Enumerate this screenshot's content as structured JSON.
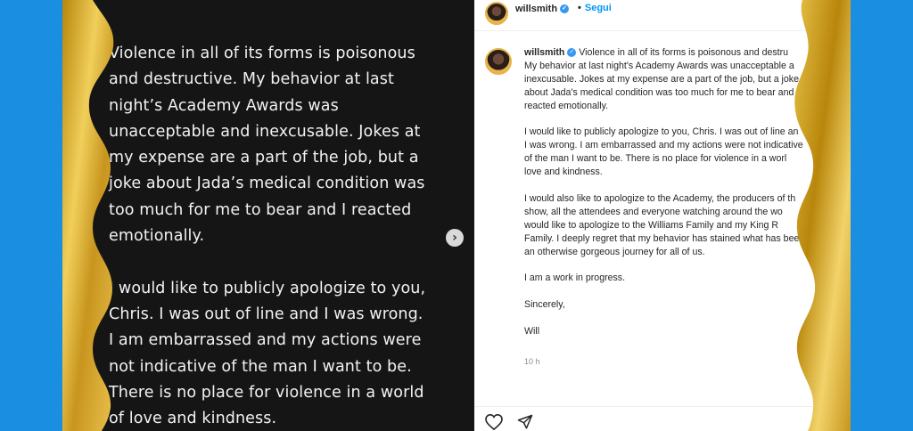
{
  "colors": {
    "background": "#1a8ee0",
    "gold": "#d4a62a",
    "dark_panel": "#151515",
    "ig_blue": "#0095f6"
  },
  "slide": {
    "text": "Violence in all of its forms is poisonous\nand destructive. My behavior at last\nnight’s Academy Awards was\nunacceptable and inexcusable. Jokes at\nmy expense are a part of the job, but a\njoke about Jada’s medical condition was\ntoo much for me to bear and I reacted\nemotionally.\n\nI would like to publicly apologize to you,\nChris. I was out of line and I was wrong.\nI am embarrassed and my actions were\nnot indicative of the man I want to be.\nThere is no place for violence in a world\nof love and kindness.",
    "next_icon": "chevron-right-icon"
  },
  "header": {
    "username": "willsmith",
    "verified_icon": "verified-badge-icon",
    "follow_label": "Segui"
  },
  "post": {
    "username": "willsmith",
    "caption_first": "Violence in all of its forms is poisonous and destru",
    "caption_rest": "My behavior at last night's Academy Awards was unacceptable a\ninexcusable. Jokes at my expense are a part of the job, but a joke\nabout Jada's medical condition was too much for me to bear and I\nreacted emotionally.\n\nI would like to publicly apologize to you, Chris. I was out of line an\nI was wrong. I am embarrassed and my actions were not indicative\nof the man I want to be. There is no place for violence in a worl\nlove and kindness.\n\nI would also like to apologize to the Academy, the producers of th\nshow, all the attendees and everyone watching around the wo\nwould like to apologize to the Williams Family and my King R\nFamily. I deeply regret that my behavior has stained what has bee\nan otherwise gorgeous journey for all of us.\n\nI am a work in progress.\n\nSincerely,\n\nWill",
    "time": "10 h"
  },
  "actions": {
    "like_icon": "heart-icon",
    "share_icon": "send-icon",
    "save_icon": "bookmark-icon"
  }
}
